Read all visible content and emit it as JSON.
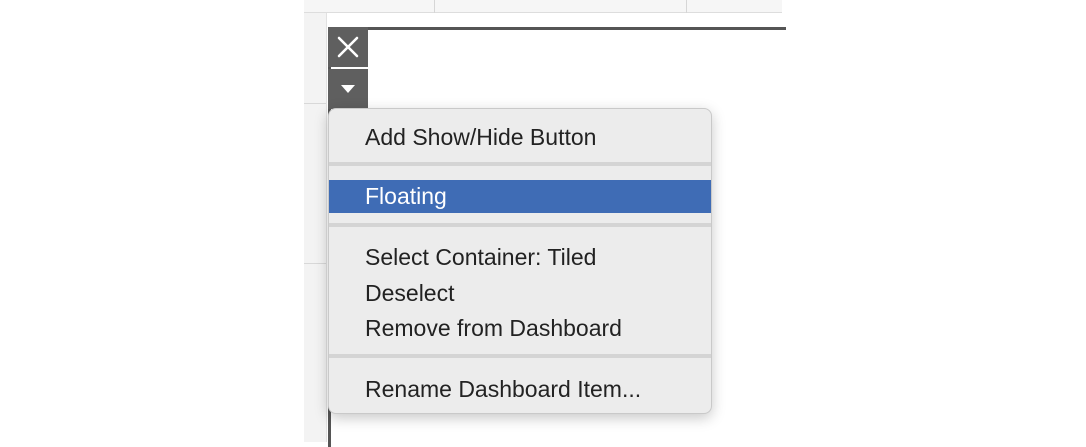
{
  "close_icon": "close-icon",
  "more_icon": "caret-down-icon",
  "menu": {
    "items": [
      {
        "label": "Add Show/Hide Button"
      },
      {
        "label": "Floating",
        "selected": true
      },
      {
        "label": "Select Container: Tiled"
      },
      {
        "label": "Deselect"
      },
      {
        "label": "Remove from Dashboard"
      },
      {
        "label": "Rename Dashboard Item..."
      }
    ]
  },
  "colors": {
    "selection": "#3f6cb5",
    "control_bg": "#5f5f5f",
    "menu_bg": "#ececec"
  }
}
